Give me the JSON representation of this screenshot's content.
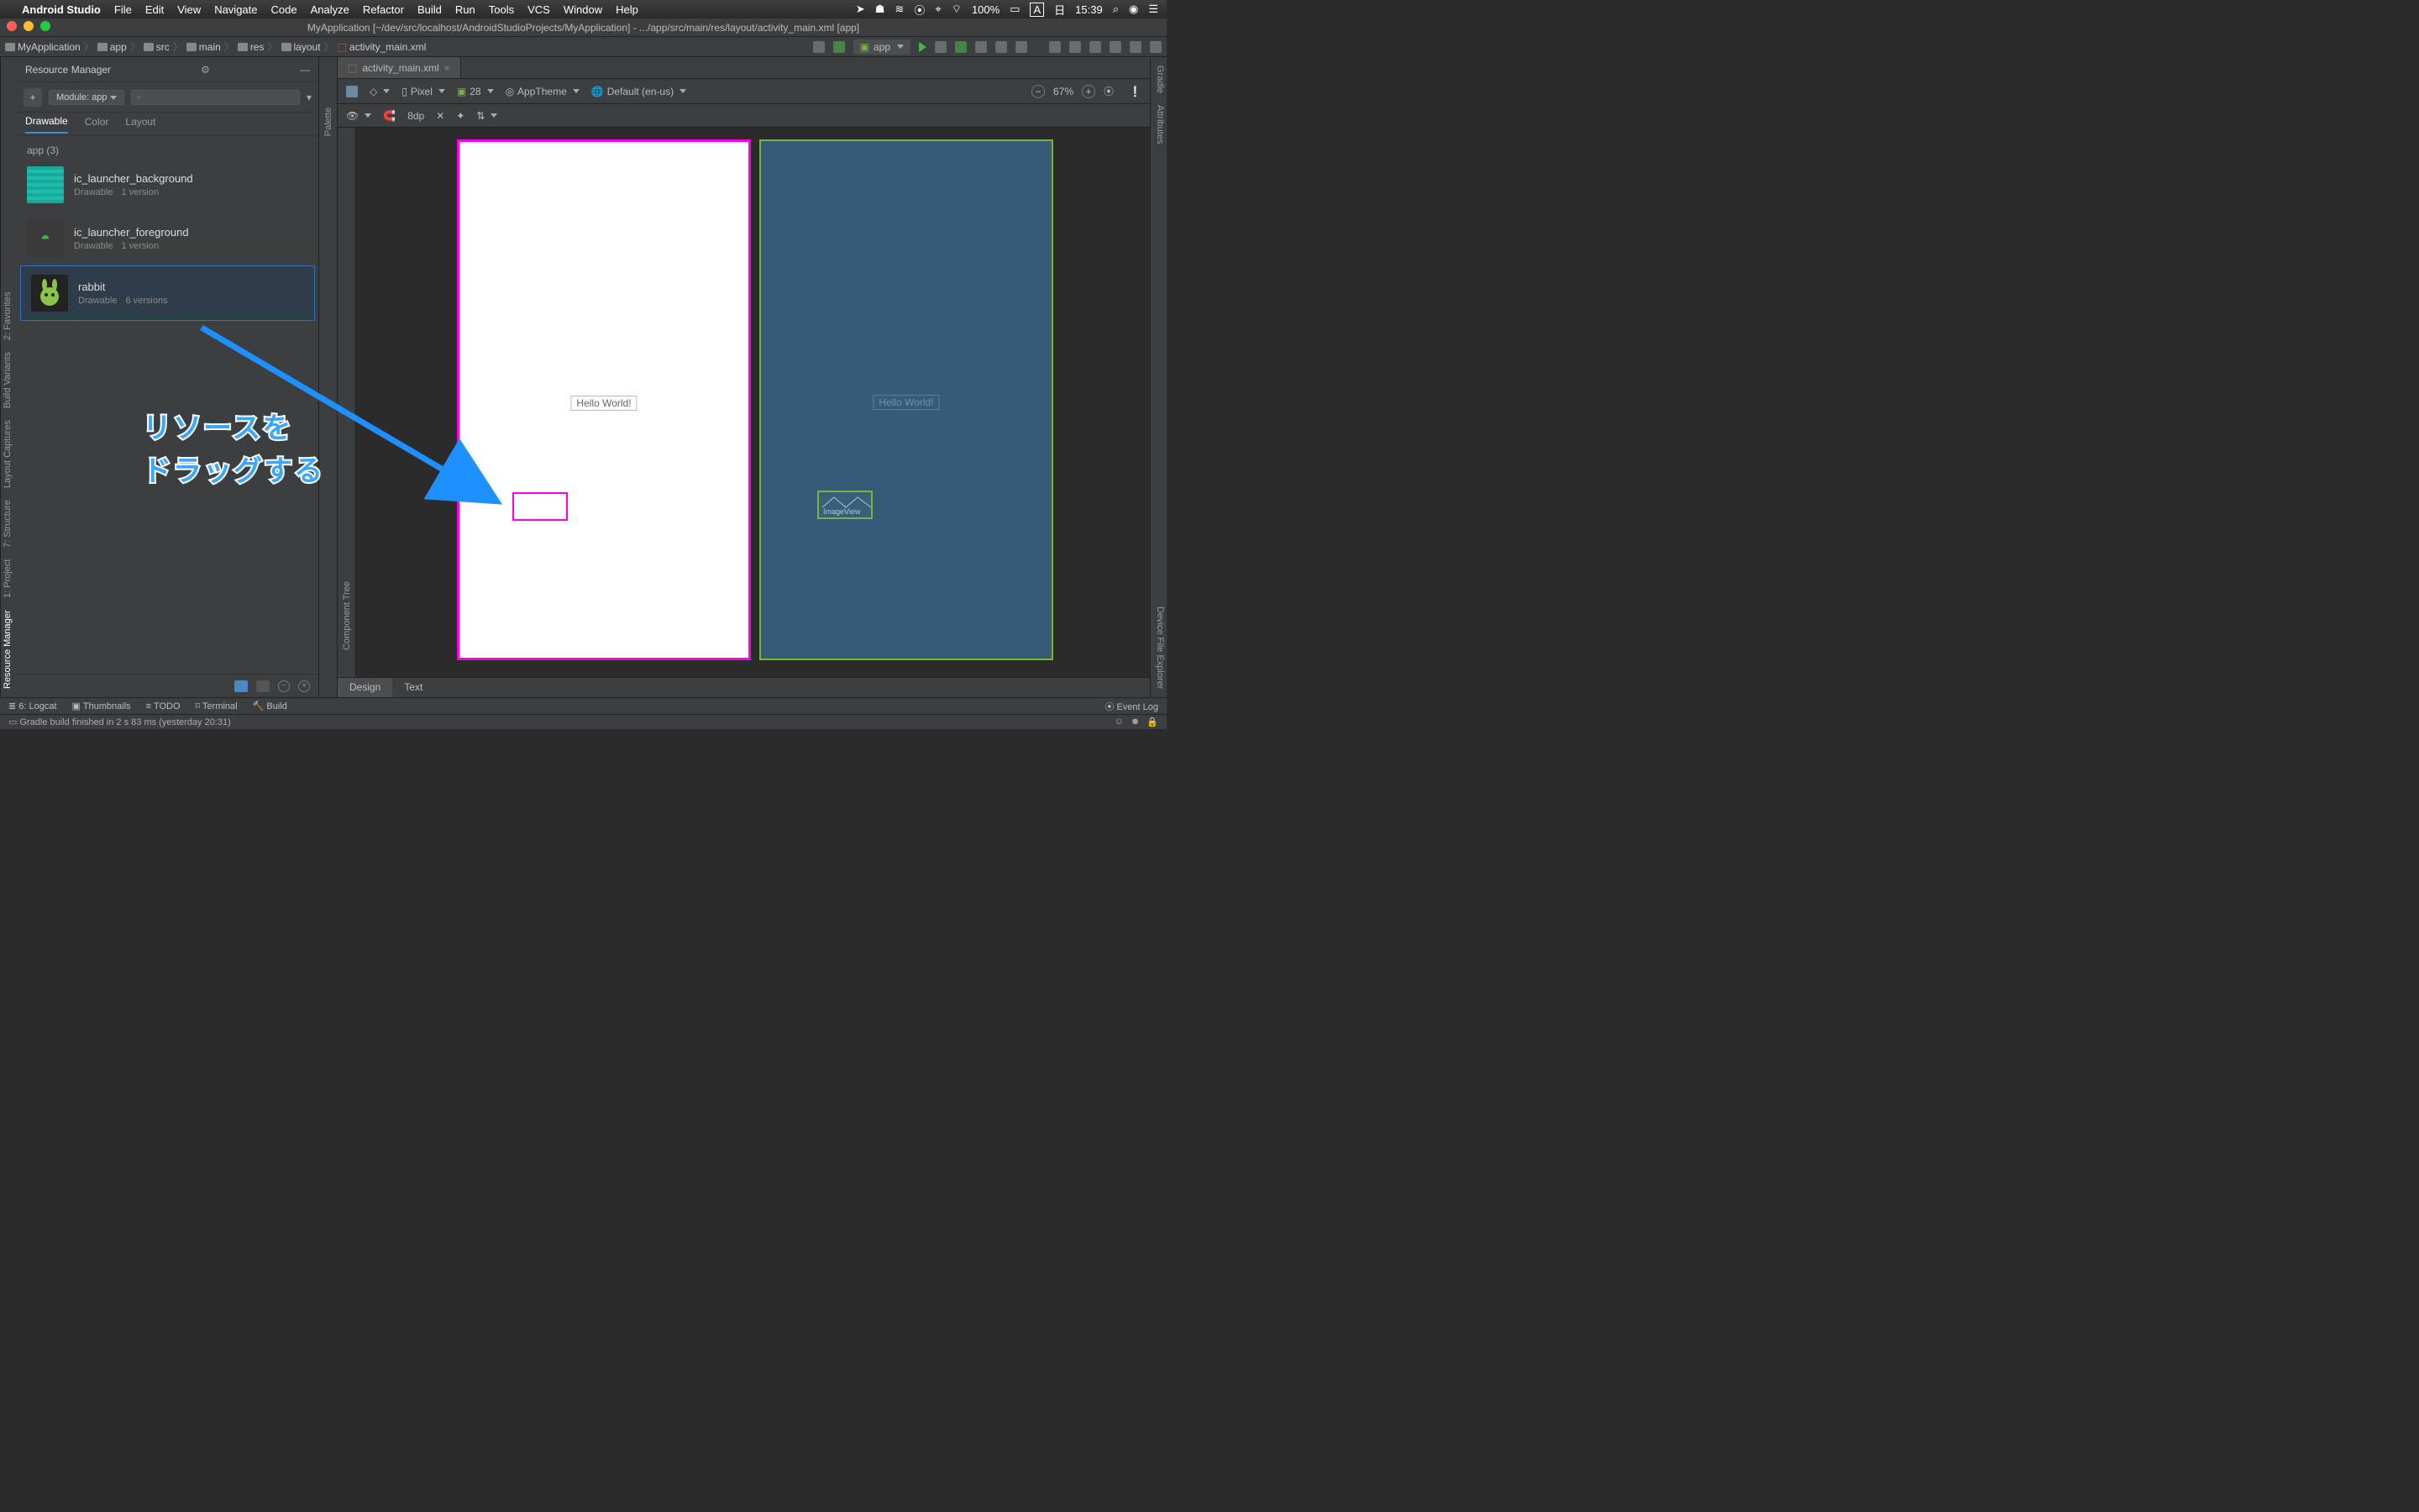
{
  "mac_menu": {
    "app": "Android Studio",
    "items": [
      "File",
      "Edit",
      "View",
      "Navigate",
      "Code",
      "Analyze",
      "Refactor",
      "Build",
      "Run",
      "Tools",
      "VCS",
      "Window",
      "Help"
    ],
    "battery": "100%",
    "input_mode": "A",
    "day": "日",
    "time": "15:39"
  },
  "window": {
    "title": "MyApplication [~/dev/src/localhost/AndroidStudioProjects/MyApplication] - .../app/src/main/res/layout/activity_main.xml [app]"
  },
  "breadcrumbs": [
    "MyApplication",
    "app",
    "src",
    "main",
    "res",
    "layout",
    "activity_main.xml"
  ],
  "run_config": "app",
  "resource_manager": {
    "title": "Resource Manager",
    "module_label": "Module: app",
    "search_placeholder": "⌕",
    "tabs": [
      "Drawable",
      "Color",
      "Layout"
    ],
    "group": "app (3)",
    "items": [
      {
        "name": "ic_launcher_background",
        "type": "Drawable",
        "versions": "1 version"
      },
      {
        "name": "ic_launcher_foreground",
        "type": "Drawable",
        "versions": "1 version"
      },
      {
        "name": "rabbit",
        "type": "Drawable",
        "versions": "6 versions"
      }
    ]
  },
  "left_tools": [
    "Resource Manager",
    "1: Project",
    "7: Structure",
    "Layout Captures",
    "Build Variants",
    "2: Favorites"
  ],
  "right_tools": [
    "Gradle",
    "Attributes",
    "Device File Explorer"
  ],
  "palette_label": "Palette",
  "component_tree_label": "Component Tree",
  "editor": {
    "tab": "activity_main.xml",
    "device": "Pixel",
    "api": "28",
    "theme": "AppTheme",
    "locale": "Default (en-us)",
    "zoom": "67%",
    "snap": "8dp",
    "design_tabs": [
      "Design",
      "Text"
    ]
  },
  "canvas": {
    "hello_text": "Hello World!",
    "image_view_label": "ImageView"
  },
  "bottom": {
    "items": [
      "6: Logcat",
      "Thumbnails",
      "TODO",
      "Terminal",
      "Build"
    ],
    "event_log": "Event Log"
  },
  "status": "Gradle build finished in 2 s 83 ms (yesterday 20:31)",
  "annotation": {
    "line1": "リソースを",
    "line2": "ドラッグする"
  }
}
